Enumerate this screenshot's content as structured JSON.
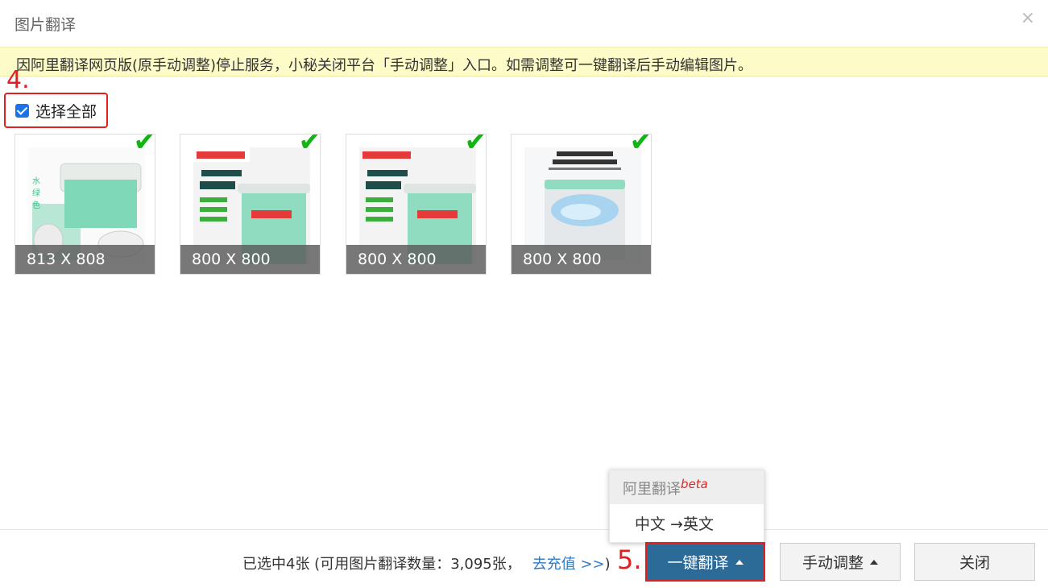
{
  "dialog": {
    "title": "图片翻译",
    "close_icon": "×",
    "notice": "因阿里翻译网页版(原手动调整)停止服务，小秘关闭平台「手动调整」入口。如需调整可一键翻译后手动编辑图片。"
  },
  "annotations": {
    "step4": "4.",
    "step5": "5."
  },
  "select_all": {
    "label": "选择全部",
    "checked": true
  },
  "images": [
    {
      "size": "813 X 808",
      "selected": true
    },
    {
      "size": "800 X 800",
      "selected": true
    },
    {
      "size": "800 X 800",
      "selected": true
    },
    {
      "size": "800 X 800",
      "selected": true
    }
  ],
  "footer": {
    "status": "已选中4张 (可用图片翻译数量：3,095张，",
    "recharge_link": "去充值 >>",
    "status_end": ")",
    "translate_button": "一键翻译",
    "manual_button": "手动调整",
    "close_button": "关闭"
  },
  "dropdown": {
    "header": "阿里翻译",
    "header_badge": "beta",
    "item": "中文 →英文"
  },
  "colors": {
    "accent": "#2c6a98",
    "annotation": "#e02020",
    "check": "#13b515",
    "link": "#2e7cc8"
  }
}
